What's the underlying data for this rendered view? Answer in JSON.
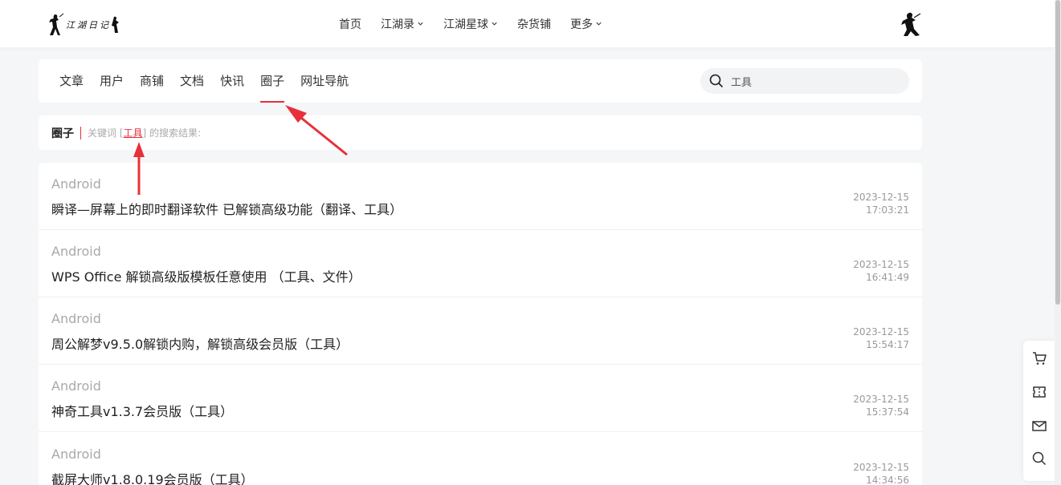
{
  "header": {
    "logo_text": "江湖日记",
    "nav": [
      {
        "label": "首页",
        "has_dropdown": false
      },
      {
        "label": "江湖录",
        "has_dropdown": true
      },
      {
        "label": "江湖星球",
        "has_dropdown": true
      },
      {
        "label": "杂货铺",
        "has_dropdown": false
      },
      {
        "label": "更多",
        "has_dropdown": true
      }
    ]
  },
  "tabs": {
    "items": [
      "文章",
      "用户",
      "商铺",
      "文档",
      "快讯",
      "圈子",
      "网址导航"
    ],
    "active": "圈子"
  },
  "search": {
    "value": "工具"
  },
  "crumb": {
    "category": "圈子",
    "prefix": "关键词 [",
    "keyword": "工具",
    "suffix": "] 的搜索结果:"
  },
  "results": [
    {
      "category": "Android",
      "title": "瞬译—屏幕上的即时翻译软件 已解锁高级功能（翻译、工具）",
      "date": "2023-12-15",
      "time": "17:03:21"
    },
    {
      "category": "Android",
      "title": "WPS Office 解锁高级版模板任意使用 （工具、文件）",
      "date": "2023-12-15",
      "time": "16:41:49"
    },
    {
      "category": "Android",
      "title": "周公解梦v9.5.0解锁内购，解锁高级会员版（工具）",
      "date": "2023-12-15",
      "time": "15:54:17"
    },
    {
      "category": "Android",
      "title": "神奇工具v1.3.7会员版（工具）",
      "date": "2023-12-15",
      "time": "15:37:54"
    },
    {
      "category": "Android",
      "title": "截屏大师v1.8.0.19会员版（工具）",
      "date": "2023-12-15",
      "time": "14:34:56"
    }
  ],
  "float_bar": [
    "cart-icon",
    "ticket-icon",
    "mail-icon",
    "search-icon"
  ],
  "colors": {
    "accent": "#e8303a",
    "background": "#f5f6f7",
    "muted": "#a7a9ad"
  }
}
